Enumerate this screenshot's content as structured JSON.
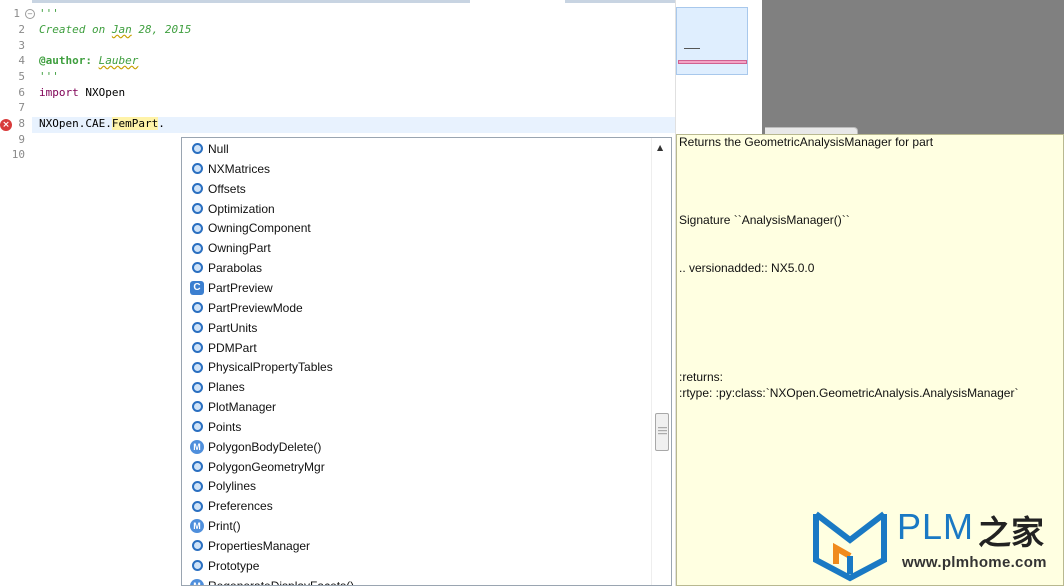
{
  "editor": {
    "line_numbers": [
      "1",
      "2",
      "3",
      "4",
      "5",
      "6",
      "7",
      "8",
      "9",
      "10"
    ],
    "line1": "'''",
    "line2_prefix": "Created on ",
    "line2_date": "Jan",
    "line2_suffix": " 28, 2015",
    "line4_tag": "@author:",
    "line4_name": "Lauber",
    "line5": "'''",
    "line6_keyword": "import",
    "line6_module": " NXOpen",
    "line8_prefix": "NXOpen.CAE.",
    "line8_highlight": "FemPart",
    "line8_suffix": ".",
    "error_icon": "error-icon"
  },
  "completion": {
    "items": [
      {
        "label": "Null",
        "kind": "field"
      },
      {
        "label": "NXMatrices",
        "kind": "field"
      },
      {
        "label": "Offsets",
        "kind": "field"
      },
      {
        "label": "Optimization",
        "kind": "field"
      },
      {
        "label": "OwningComponent",
        "kind": "field"
      },
      {
        "label": "OwningPart",
        "kind": "field"
      },
      {
        "label": "Parabolas",
        "kind": "field"
      },
      {
        "label": "PartPreview",
        "kind": "class"
      },
      {
        "label": "PartPreviewMode",
        "kind": "field"
      },
      {
        "label": "PartUnits",
        "kind": "field"
      },
      {
        "label": "PDMPart",
        "kind": "field"
      },
      {
        "label": "PhysicalPropertyTables",
        "kind": "field"
      },
      {
        "label": "Planes",
        "kind": "field"
      },
      {
        "label": "PlotManager",
        "kind": "field"
      },
      {
        "label": "Points",
        "kind": "field"
      },
      {
        "label": "PolygonBodyDelete()",
        "kind": "method"
      },
      {
        "label": "PolygonGeometryMgr",
        "kind": "field"
      },
      {
        "label": "Polylines",
        "kind": "field"
      },
      {
        "label": "Preferences",
        "kind": "field"
      },
      {
        "label": "Print()",
        "kind": "method"
      },
      {
        "label": "PropertiesManager",
        "kind": "field"
      },
      {
        "label": "Prototype",
        "kind": "field"
      },
      {
        "label": "RegenerateDisplayFacets()",
        "kind": "method"
      }
    ],
    "class_glyph": "C",
    "method_glyph": "M"
  },
  "doc": {
    "summary": "Returns the GeometricAnalysisManager for part",
    "signature": "Signature ``AnalysisManager()``",
    "version": ".. versionadded:: NX5.0.0",
    "returns": ":returns:",
    "rtype": ":rtype: :py:class:`NXOpen.GeometricAnalysis.AnalysisManager`"
  },
  "watermark": {
    "brand": "PLM",
    "brand_cjk": "之家",
    "url": "www.plmhome.com"
  },
  "colors": {
    "docstring": "#3f9f3f",
    "keyword": "#7f0055",
    "highlight": "#fff3a8",
    "tooltip_bg": "#ffffe1",
    "brand_blue": "#1a79c4",
    "brand_orange": "#f08a1c"
  }
}
